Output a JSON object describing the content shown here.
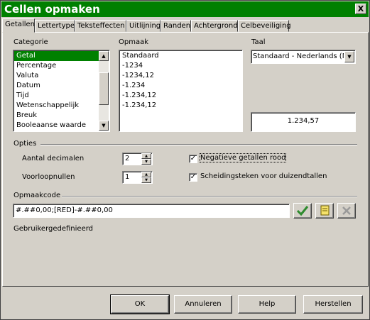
{
  "window": {
    "title": "Cellen opmaken",
    "close_glyph": "X"
  },
  "tabs": [
    {
      "label": "Getallen",
      "active": true
    },
    {
      "label": "Lettertype"
    },
    {
      "label": "Teksteffecten"
    },
    {
      "label": "Uitlijning"
    },
    {
      "label": "Randen"
    },
    {
      "label": "Achtergrond"
    },
    {
      "label": "Celbeveiliging"
    }
  ],
  "categorie": {
    "label": "Categorie",
    "items": [
      "Getal",
      "Percentage",
      "Valuta",
      "Datum",
      "Tijd",
      "Wetenschappelijk",
      "Breuk",
      "Booleaanse waarde"
    ],
    "selected": "Getal"
  },
  "opmaak": {
    "label": "Opmaak",
    "items": [
      "Standaard",
      "-1234",
      "-1234,12",
      "-1.234",
      "-1.234,12",
      "-1.234,12"
    ]
  },
  "taal": {
    "label": "Taal",
    "value": "Standaard - Nederlands (N"
  },
  "preview": {
    "value": "1.234,57"
  },
  "opties": {
    "label": "Opties",
    "aantal_decimalen": {
      "label": "Aantal decimalen",
      "value": "2"
    },
    "voorloopnullen": {
      "label": "Voorloopnullen",
      "value": "1"
    },
    "negatieve_rood": {
      "label": "Negatieve getallen rood",
      "checked": true
    },
    "scheidingsteken": {
      "label": "Scheidingsteken voor duizendtallen",
      "checked": true
    }
  },
  "opmaakcode": {
    "label": "Opmaakcode",
    "value": "#.##0,00;[RED]-#.##0,00",
    "description": "Gebruikergedefinieerd"
  },
  "buttons": {
    "ok": "OK",
    "annuleren": "Annuleren",
    "help": "Help",
    "herstellen": "Herstellen"
  },
  "colors": {
    "accent": "#008000",
    "face": "#d4d0c8",
    "checkmark": "#2e8b2e"
  }
}
